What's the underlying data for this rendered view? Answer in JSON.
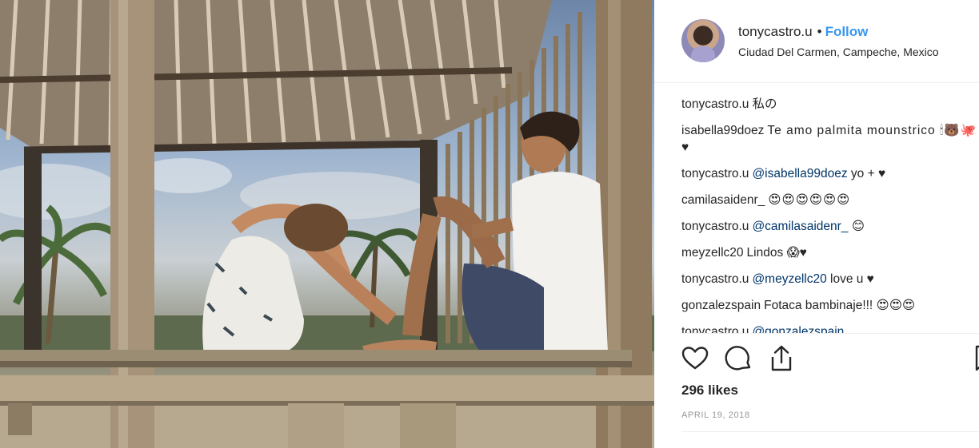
{
  "post": {
    "username": "tonycastro.u",
    "separator": "•",
    "follow_label": "Follow",
    "location": "Ciudad Del Carmen, Campeche, Mexico"
  },
  "comments": [
    {
      "user": "tonycastro.u",
      "text": "私の",
      "mention": ""
    },
    {
      "user": "isabella99doez",
      "text": "Te amo palmita mounstrico 🕯🐻🐙♥",
      "mention": ""
    },
    {
      "user": "tonycastro.u",
      "mention": "@isabella99doez",
      "text": "yo + ♥"
    },
    {
      "user": "camilasaidenr_",
      "text": "😍😍😍😍😍😍",
      "mention": ""
    },
    {
      "user": "tonycastro.u",
      "mention": "@camilasaidenr_",
      "text": "😊"
    },
    {
      "user": "meyzellc20",
      "text": "Lindos 😱♥",
      "mention": ""
    },
    {
      "user": "tonycastro.u",
      "mention": "@meyzellc20",
      "text": "love u ♥"
    },
    {
      "user": "gonzalezspain",
      "text": "Fotaca bambinaje!!! 😍😍😍",
      "mention": ""
    },
    {
      "user": "tonycastro.u",
      "mention": "@gonzalezspain",
      "text": ""
    }
  ],
  "actions": {
    "like_icon": "heart-icon",
    "comment_icon": "comment-bubble-icon",
    "share_icon": "share-upload-icon",
    "save_icon": "bookmark-icon"
  },
  "likes": "296 likes",
  "date": "APRIL 19, 2018",
  "colors": {
    "link": "#3897f0",
    "mention": "#003569",
    "text": "#262626",
    "muted": "#999999"
  }
}
